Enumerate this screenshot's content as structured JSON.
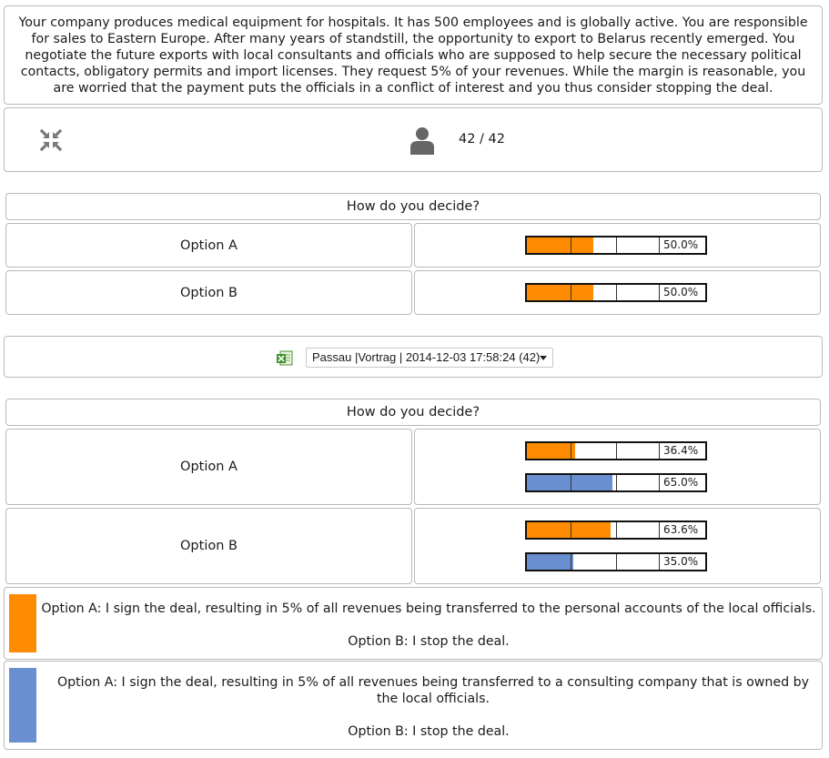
{
  "scenario": {
    "text": "Your company produces medical equipment for hospitals. It has 500 employees and is globally active. You are responsible for sales to Eastern Europe. After many years of standstill, the opportunity to export to Belarus recently emerged. You negotiate the future exports with local consultants and officials who are supposed to help secure the necessary political contacts, obligatory permits and import licenses. They request 5% of your revenues. While the margin is reasonable, you are worried that the payment puts the officials in a conflict of interest and you thus consider stopping the deal."
  },
  "controls": {
    "compress_icon": "compress-arrows-icon",
    "user_icon": "user-icon",
    "participants": "42 / 42"
  },
  "poll1": {
    "question": "How do you decide?",
    "options": [
      {
        "label": "Option A",
        "orange_pct": 50.0,
        "orange_text": "50.0%"
      },
      {
        "label": "Option B",
        "orange_pct": 50.0,
        "orange_text": "50.0%"
      }
    ]
  },
  "session": {
    "excel_icon": "excel-export-icon",
    "selected": "Passau |Vortrag | 2014-12-03 17:58:24 (42)"
  },
  "poll2": {
    "question": "How do you decide?",
    "options": [
      {
        "label": "Option A",
        "orange_pct": 36.4,
        "orange_text": "36.4%",
        "blue_pct": 65.0,
        "blue_text": "65.0%"
      },
      {
        "label": "Option B",
        "orange_pct": 63.6,
        "orange_text": "63.6%",
        "blue_pct": 35.0,
        "blue_text": "35.0%"
      }
    ]
  },
  "legend": {
    "orange": {
      "color": "#ff8c00",
      "option_a": "Option A: I sign the deal, resulting in 5% of all revenues being transferred to the personal accounts of the local officials.",
      "option_b": "Option B: I stop the deal."
    },
    "blue": {
      "color": "#6a8fd1",
      "option_a": "Option A: I sign the deal, resulting in 5% of all revenues being transferred to a consulting company that is owned by the local officials.",
      "option_b": "Option B: I stop the deal."
    }
  }
}
